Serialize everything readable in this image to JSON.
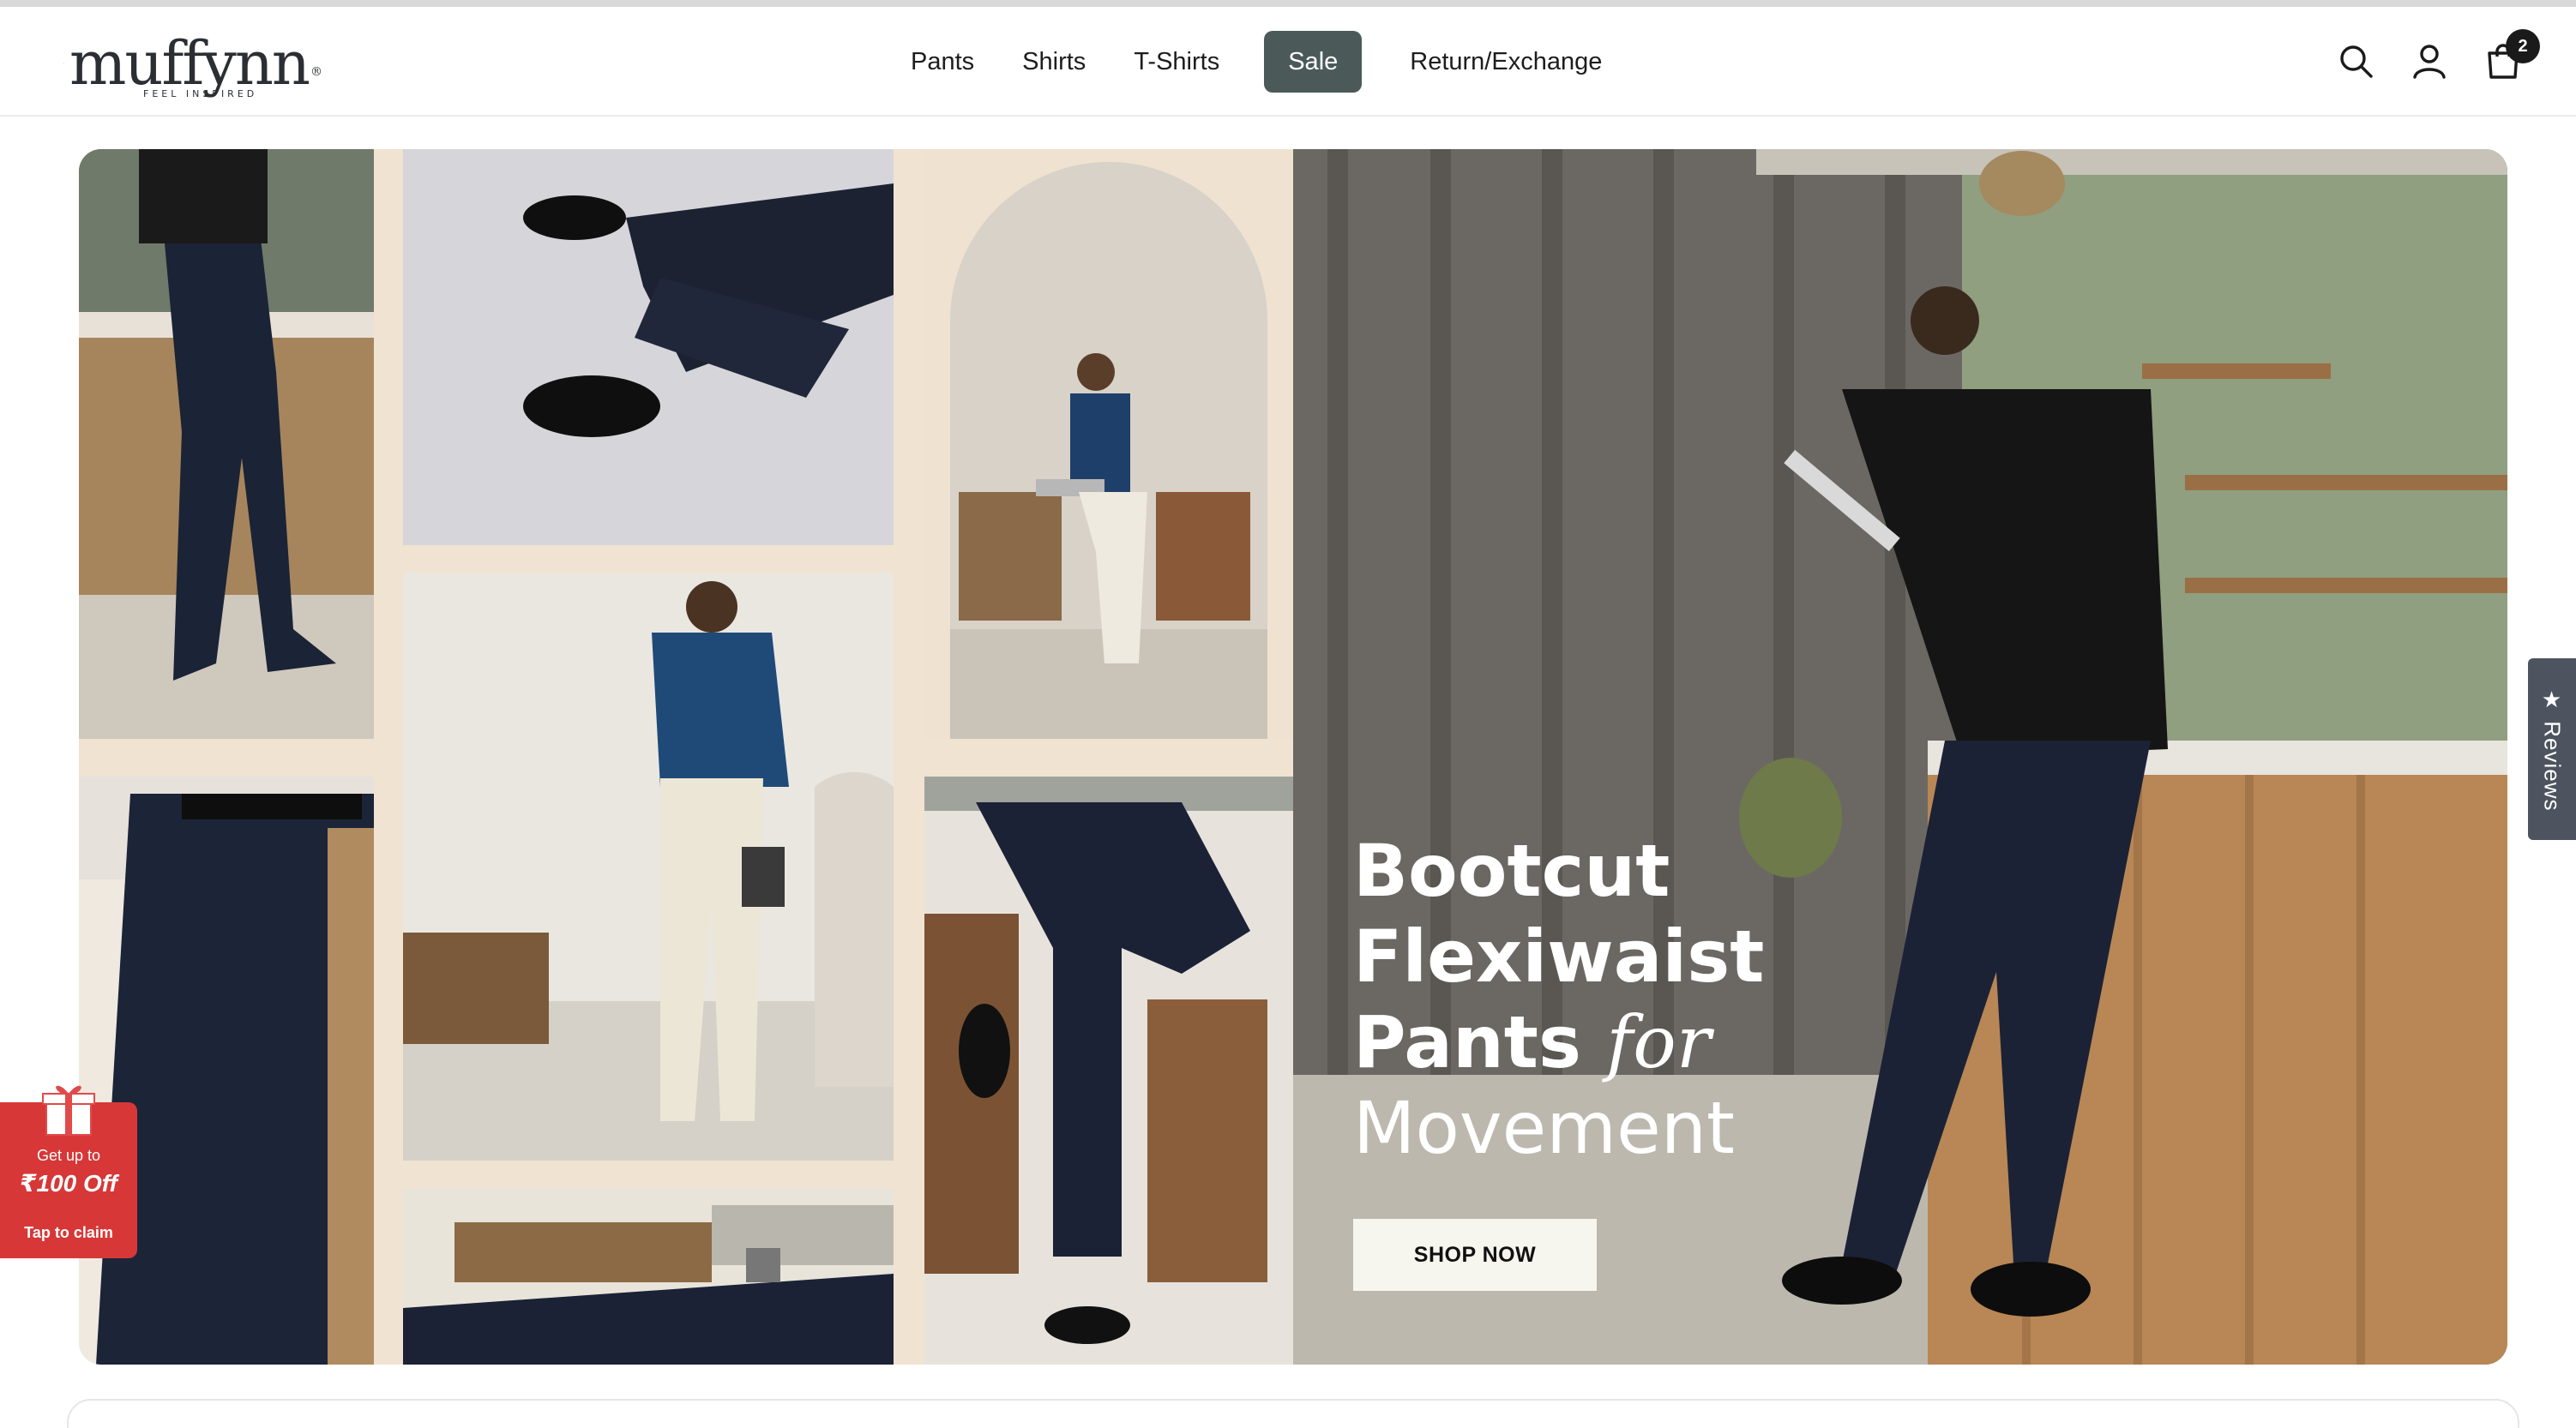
{
  "brand": {
    "name": "muffynn",
    "registered": "®",
    "tagline": "Feel Inspired"
  },
  "nav": {
    "items": [
      {
        "label": "Pants"
      },
      {
        "label": "Shirts"
      },
      {
        "label": "T-Shirts"
      },
      {
        "label": "Sale",
        "active": true
      },
      {
        "label": "Return/Exchange"
      }
    ]
  },
  "header_icons": {
    "search": "search-icon",
    "account": "user-icon",
    "cart": "cart-icon",
    "cart_count": "2"
  },
  "hero": {
    "line1": "Bootcut",
    "line2": "Flexiwaist",
    "line3_a": "Pants",
    "line3_b": "for",
    "line4": "Movement",
    "cta": "SHOP NOW",
    "slides_total": 4,
    "active_slide": 1
  },
  "reviews_tab": {
    "label": "★ Reviews"
  },
  "offer": {
    "top": "Get up to",
    "amount": "₹100 Off",
    "claim": "Tap to claim"
  },
  "colors": {
    "nav_active_bg": "#4b5a59",
    "offer_bg": "#d73737",
    "reviews_bg": "#4d5460",
    "hero_bg": "#f0e3d2"
  }
}
